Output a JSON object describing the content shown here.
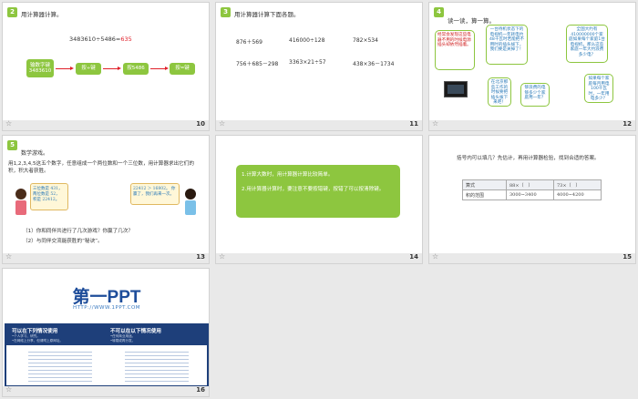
{
  "slides": [
    {
      "number": "10",
      "badge": "2",
      "title": "用计算器计算。",
      "equation_prefix": "3483610÷5486=",
      "equation_answer": "635",
      "steps": [
        "输数字键 3483610",
        "按÷键",
        "按5486",
        "按=键"
      ]
    },
    {
      "number": "11",
      "badge": "3",
      "title": "用计算器计算下面各题。",
      "problems": [
        "876＋569",
        "416000÷128",
        "782×534",
        "756＋685－298",
        "3363×21÷57",
        "438×36－1734"
      ]
    },
    {
      "number": "12",
      "badge": "4",
      "title": "读一读，算一算。",
      "left_note": "经常会发现这些电器不用的时候电源插头却依然插着。",
      "bubble_1": "一台待机状态下的电视机一年耗电约48千瓦时若能把不用时的插头拔下，我们要是关掉了！",
      "bubble_2": "全国大约有410000000个家庭如果每个家庭1台电视机，那么这些家庭一年大约浪费多少电？",
      "bubble_3": "在北京那些工作的时候要把插头拔下来吧！",
      "bubble_4": "够浪费的电够多少个家庭用一年？",
      "bubble_5": "如果每个家庭每月用电100千瓦时，一年用电多少？"
    },
    {
      "number": "13",
      "badge": "5",
      "title": "数学游戏。",
      "desc": "用1,2,3,4,5这五个数字，任意组成一个两位数和一个三位数，用计算器求出它们的积，积大者获胜。",
      "left_card": [
        "三位数是 431，",
        "两位数是 52，",
        "积是 22412。"
      ],
      "right_card": [
        "22412 ＞ 16802。 你",
        "赢了，我们再来一次。"
      ],
      "q1": "（1）你和同伴共进行了几次游戏？你赢了几次？",
      "q2": "（2）与同伴交流能获胜的“秘诀”。"
    },
    {
      "number": "14",
      "tip_1": "1.计算大数时，用计算器计算比较简单。",
      "tip_2": "2.用计算器计算时，要注意不要按错键，按错了可以按清除键。"
    },
    {
      "number": "15",
      "title": "括号内可以填几？先估计，再用计算器检验，找到合适的答案。",
      "table": {
        "rows": [
          [
            "算式",
            "88×（　）",
            "73×（　）"
          ],
          [
            "积的范围",
            "3000~3400",
            "4000~4200"
          ]
        ]
      }
    },
    {
      "number": "16",
      "logo_text": "第一PPT",
      "logo_url": "HTTP://WWW.1PPT.COM",
      "can_title": "可以在下列情况使用",
      "can_lines": [
        "•个人学习、研究。",
        "•在网络上分享，但请附上原网址。"
      ],
      "cannot_title": "不可以在以下情况使用",
      "cannot_lines": [
        "•任何商业用途。",
        "•转载或再分发。"
      ]
    }
  ]
}
